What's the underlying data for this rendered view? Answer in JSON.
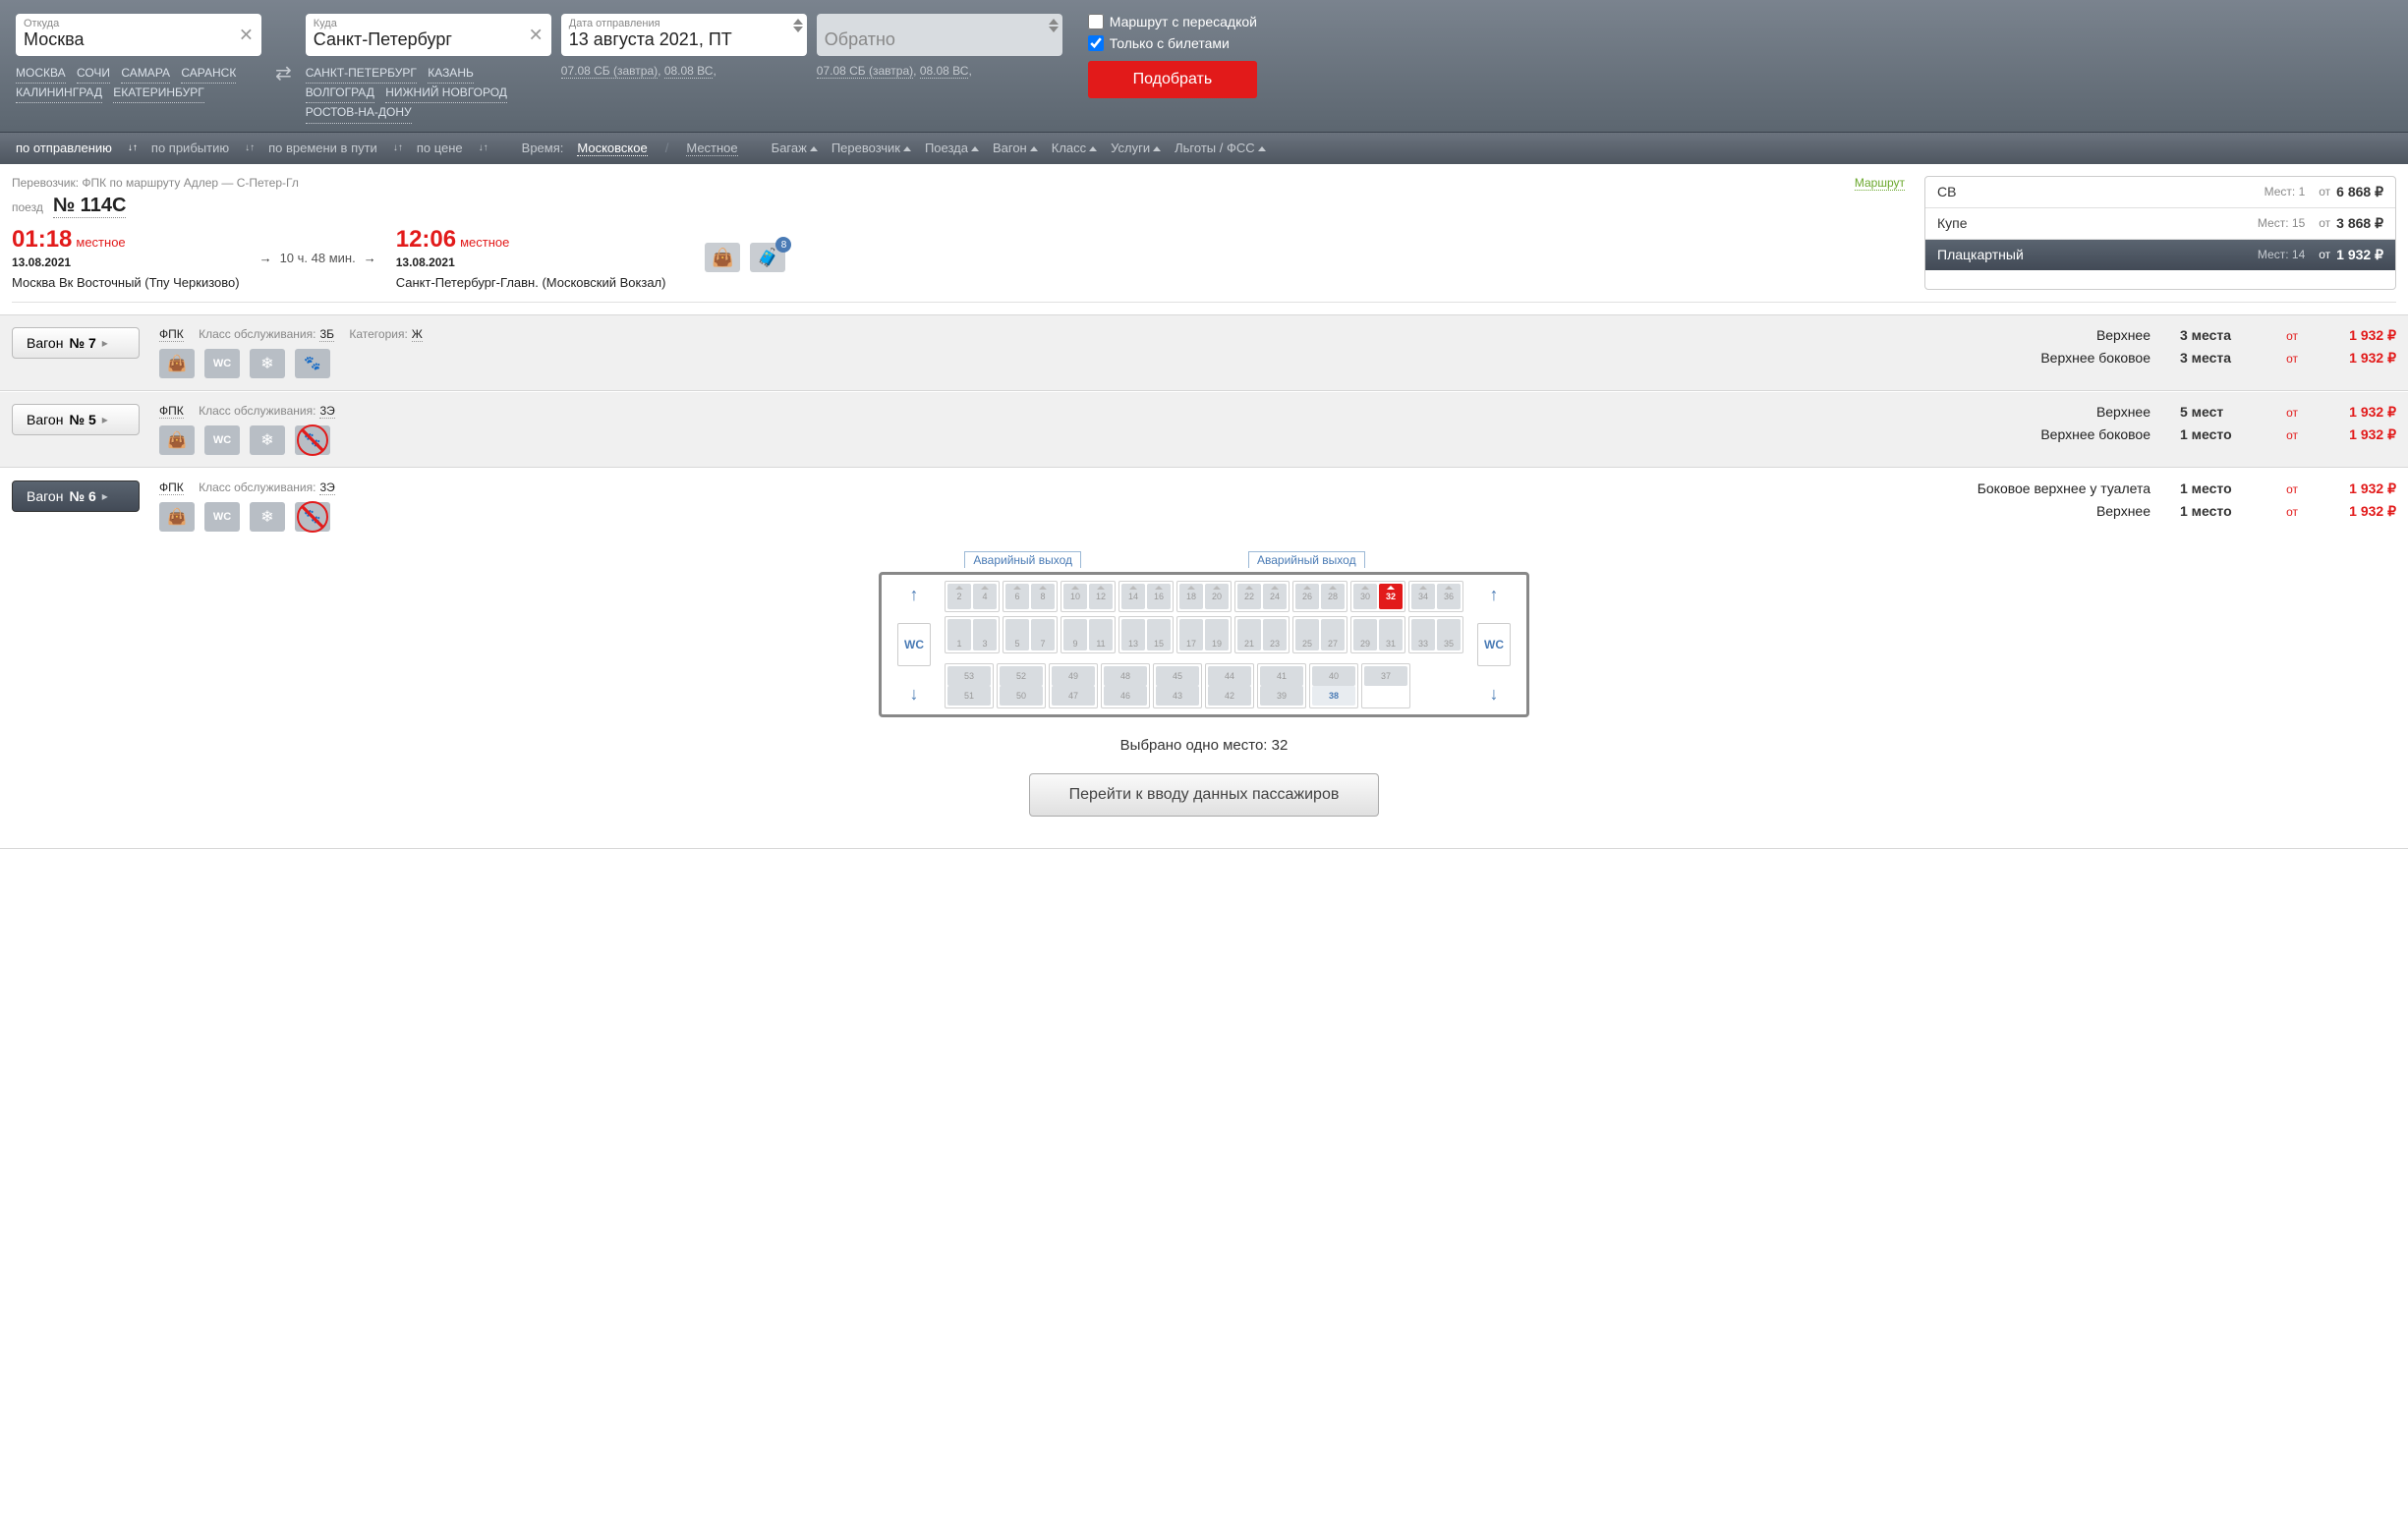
{
  "search": {
    "from_label": "Откуда",
    "from_value": "Москва",
    "to_label": "Куда",
    "to_value": "Санкт-Петербург",
    "date_label": "Дата отправления",
    "date_value": "13 августа 2021, ПТ",
    "return_label": "Обратно",
    "from_quick": [
      "МОСКВА",
      "СОЧИ",
      "САМАРА",
      "САРАНСК",
      "КАЛИНИНГРАД",
      "ЕКАТЕРИНБУРГ"
    ],
    "to_quick": [
      "САНКТ-ПЕТЕРБУРГ",
      "КАЗАНЬ",
      "ВОЛГОГРАД",
      "НИЖНИЙ НОВГОРОД",
      "РОСТОВ-НА-ДОНУ"
    ],
    "date_hint1": "07.08 СБ (завтра)",
    "date_hint2": "08.08 ВС",
    "opt_transfer": "Маршрут с пересадкой",
    "opt_tickets": "Только с билетами",
    "btn_search": "Подобрать"
  },
  "filters": {
    "sort_dep": "по отправлению",
    "sort_arr": "по прибытию",
    "sort_dur": "по времени в пути",
    "sort_price": "по цене",
    "time_label": "Время:",
    "time_msk": "Московское",
    "time_local": "Местное",
    "baggage": "Багаж",
    "carrier": "Перевозчик",
    "trains": "Поезда",
    "wagon": "Вагон",
    "class": "Класс",
    "services": "Услуги",
    "benefits": "Льготы / ФСС"
  },
  "train": {
    "carrier": "Перевозчик: ФПК   по маршруту Адлер — С-Петер-Гл",
    "route_link": "Маршрут",
    "no_label": "поезд",
    "number": "№ 114С",
    "dep_time": "01:18",
    "dep_local": "местное",
    "dep_date": "13.08.2021",
    "dep_station": "Москва Вк Восточный (Тпу Черкизово)",
    "duration": "10 ч. 48 мин.",
    "arr_time": "12:06",
    "arr_local": "местное",
    "arr_date": "13.08.2021",
    "arr_station": "Санкт-Петербург-Главн. (Московский Вокзал)",
    "badge": "8"
  },
  "classes": [
    {
      "name": "СВ",
      "seats_label": "Мест: 1",
      "from": "от",
      "price": "6 868 ₽"
    },
    {
      "name": "Купе",
      "seats_label": "Мест: 15",
      "from": "от",
      "price": "3 868 ₽"
    },
    {
      "name": "Плацкартный",
      "seats_label": "Мест: 14",
      "from": "от",
      "price": "1 932 ₽"
    }
  ],
  "wagons": [
    {
      "btn_label": "Вагон",
      "btn_no": "№ 7",
      "carrier": "ФПК",
      "service_label": "Класс обслуживания:",
      "service": "3Б",
      "cat_label": "Категория:",
      "cat": "Ж",
      "seats": [
        {
          "type": "Верхнее",
          "count": "3 места",
          "from": "от",
          "price": "1 932 ₽"
        },
        {
          "type": "Верхнее боковое",
          "count": "3 места",
          "from": "от",
          "price": "1 932 ₽"
        }
      ]
    },
    {
      "btn_label": "Вагон",
      "btn_no": "№ 5",
      "carrier": "ФПК",
      "service_label": "Класс обслуживания:",
      "service": "3Э",
      "seats": [
        {
          "type": "Верхнее",
          "count": "5 мест",
          "from": "от",
          "price": "1 932 ₽"
        },
        {
          "type": "Верхнее боковое",
          "count": "1 место",
          "from": "от",
          "price": "1 932 ₽"
        }
      ]
    },
    {
      "btn_label": "Вагон",
      "btn_no": "№ 6",
      "carrier": "ФПК",
      "service_label": "Класс обслуживания:",
      "service": "3Э",
      "seats": [
        {
          "type": "Боковое верхнее у туалета",
          "count": "1 место",
          "from": "от",
          "price": "1 932 ₽"
        },
        {
          "type": "Верхнее",
          "count": "1 место",
          "from": "от",
          "price": "1 932 ₽"
        }
      ]
    }
  ],
  "seatmap": {
    "exit_label": "Аварийный выход",
    "wc": "WC",
    "selected_seat": "32",
    "available_side": "38",
    "upper_seats": [
      "2",
      "4",
      "6",
      "8",
      "10",
      "12",
      "14",
      "16",
      "18",
      "20",
      "22",
      "24",
      "26",
      "28",
      "30",
      "32",
      "34",
      "36"
    ],
    "lower_seats": [
      "1",
      "3",
      "5",
      "7",
      "9",
      "11",
      "13",
      "15",
      "17",
      "19",
      "21",
      "23",
      "25",
      "27",
      "29",
      "31",
      "33",
      "35"
    ],
    "side_seats": [
      "53",
      "51",
      "52",
      "50",
      "49",
      "47",
      "48",
      "46",
      "45",
      "43",
      "44",
      "42",
      "41",
      "39",
      "40",
      "38",
      "37"
    ]
  },
  "footer": {
    "selected_info": "Выбрано одно место: 32",
    "proceed": "Перейти к вводу данных пассажиров"
  }
}
